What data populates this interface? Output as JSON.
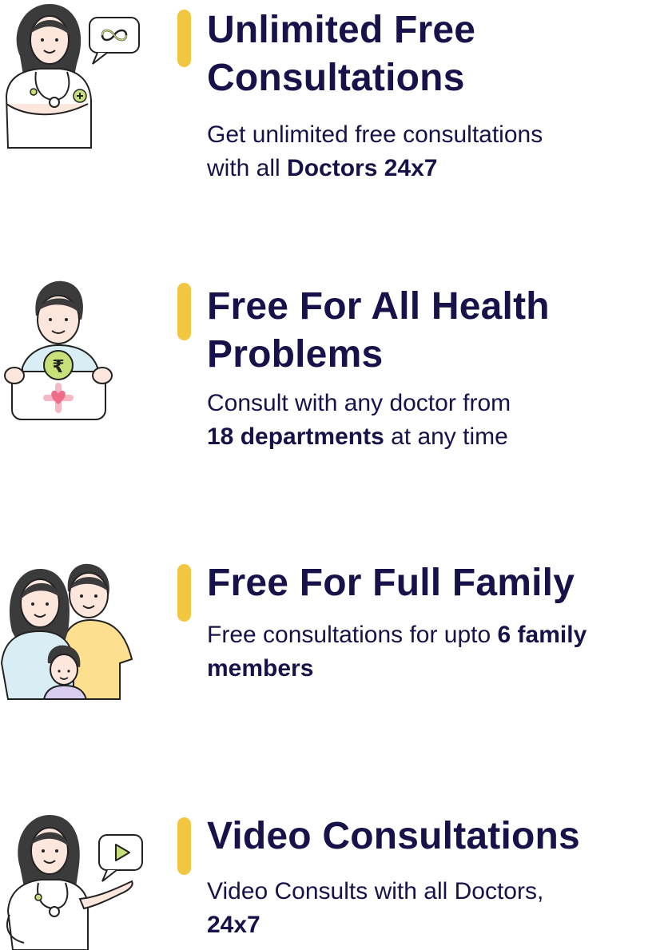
{
  "features": [
    {
      "title_line1": "Unlimited Free",
      "title_line2": "Consultations",
      "desc_line1": "Get unlimited free consultations",
      "desc_line2_plain": "with all ",
      "desc_line2_bold": "Doctors 24x7",
      "illustration": "doctor-infinity-illustration"
    },
    {
      "title_line1": "Free For All Health",
      "title_line2": "Problems",
      "desc_line1": "Consult with any doctor from",
      "desc_line2_bold": "18 departments",
      "desc_line2_plain": " at any time",
      "illustration": "man-rupee-board-illustration"
    },
    {
      "title_line1": "Free For Full Family",
      "desc_line1_plain": "Free consultations for upto ",
      "desc_line1_bold": "6 family",
      "desc_line2_bold": "members",
      "illustration": "family-illustration"
    },
    {
      "title_line1": "Video Consultations",
      "desc_line1": "Video Consults with all Doctors,",
      "desc_line2_bold": "24x7",
      "illustration": "doctor-video-illustration"
    }
  ],
  "colors": {
    "accent_bar": "#f2c641",
    "text": "#17134a",
    "illustration_green": "#c8e07a",
    "illustration_skin": "#fde7dd",
    "illustration_hair": "#3b3b3b"
  }
}
